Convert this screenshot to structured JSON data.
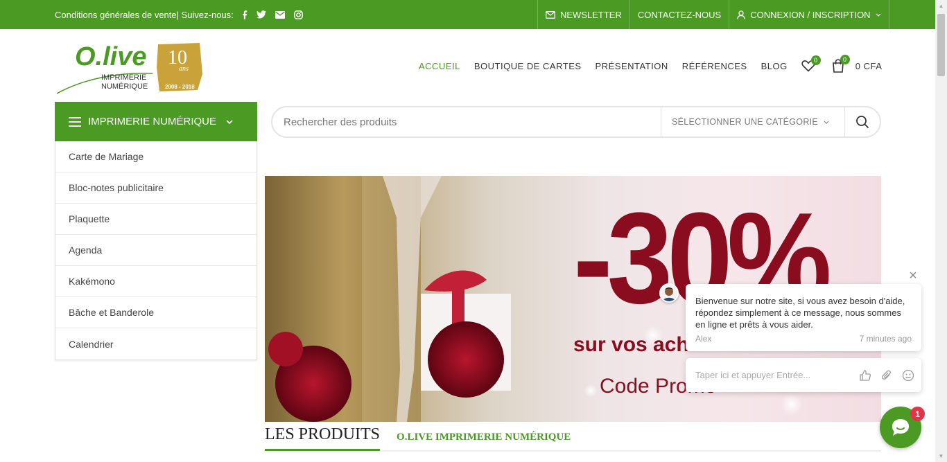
{
  "topbar": {
    "conditions": "Conditions générales de vente| Suivez-nous:",
    "social": [
      "facebook-icon",
      "twitter-icon",
      "envelope-icon",
      "instagram-icon"
    ],
    "newsletter": "NEWSLETTER",
    "contact": "CONTACTEZ-NOUS",
    "login": "CONNEXION / INSCRIPTION"
  },
  "logo": {
    "brand": "O.live",
    "line1": "IMPRIMERIE",
    "line2": "NUMÉRIQUE",
    "anniversary": "10",
    "anniversary_word": "ans",
    "years": "2008 - 2018"
  },
  "nav": {
    "items": [
      {
        "label": "ACCUEIL",
        "active": true
      },
      {
        "label": "BOUTIQUE DE CARTES",
        "active": false
      },
      {
        "label": "PRÉSENTATION",
        "active": false
      },
      {
        "label": "RÉFÉRENCES",
        "active": false
      },
      {
        "label": "BLOG",
        "active": false
      }
    ],
    "wishlist_count": "0",
    "cart_count": "0",
    "cart_total": "0 CFA"
  },
  "categories": {
    "button_label": "IMPRIMERIE NUMÉRIQUE",
    "items": [
      "Carte de Mariage",
      "Bloc-notes publicitaire",
      "Plaquette",
      "Agenda",
      "Kakémono",
      "Bâche et Banderole",
      "Calendrier"
    ]
  },
  "search": {
    "placeholder": "Rechercher des produits",
    "category_select": "SÉLECTIONNER UNE CATÉGORIE"
  },
  "banner": {
    "discount": "-30%",
    "line2": "sur vos ach",
    "line2_bold": "ach",
    "promo": "Code Promo"
  },
  "products": {
    "tab1": "LES PRODUITS",
    "tab2": "O.LIVE IMPRIMERIE NUMÉRIQUE"
  },
  "chat": {
    "message": "Bienvenue sur notre site, si vous avez besoin d'aide, répondez simplement à ce message, nous sommes en ligne et prêts à vous aider.",
    "agent": "Alex",
    "time": "7 minutes ago",
    "input_placeholder": "Taper ici et appuyer Entrée...",
    "unread": "1"
  },
  "colors": {
    "brand_green": "#4a9a24",
    "badge_red": "#e0344b",
    "banner_red": "#8a0d1f"
  }
}
